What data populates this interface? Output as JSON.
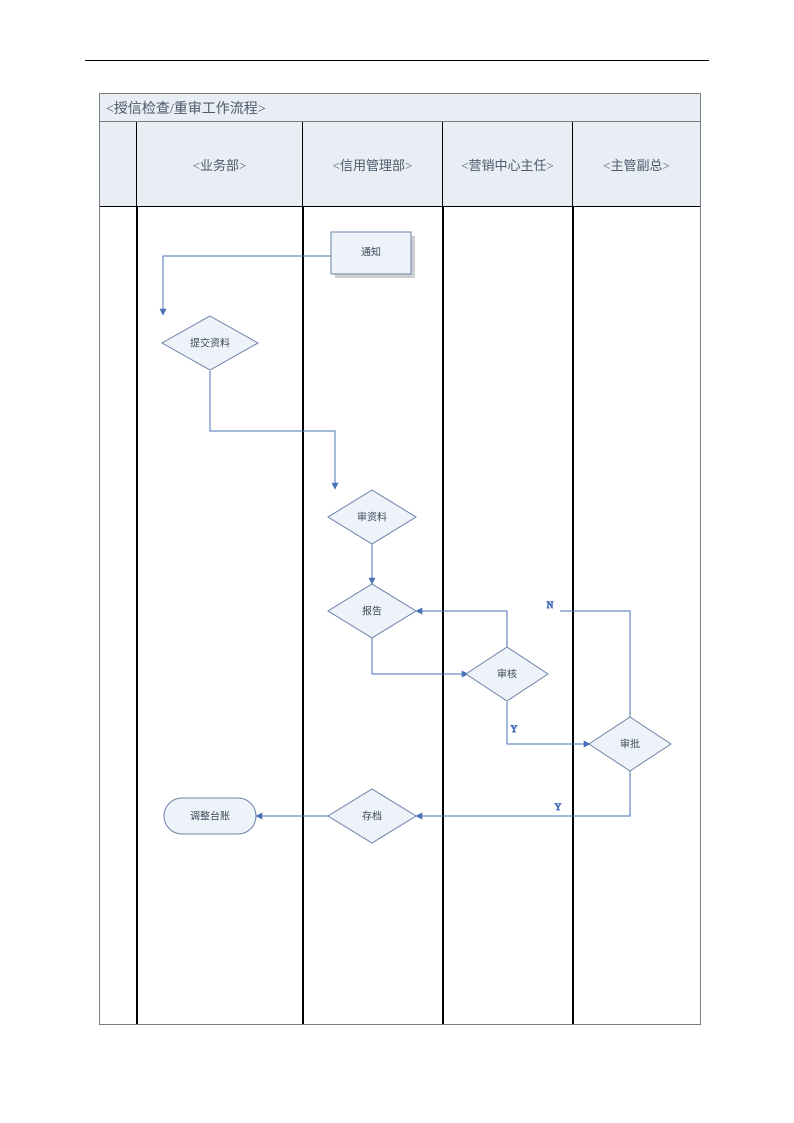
{
  "title": "<授信检查/重审工作流程>",
  "lanes": {
    "l1": "",
    "l2": "<业务部>",
    "l3": "<信用管理部>",
    "l4": "<营销中心主任>",
    "l5": "<主管副总>"
  },
  "nodes": {
    "notify": "通知",
    "submit": "提交资料",
    "reviewDoc": "审资料",
    "report": "报告",
    "audit": "审核",
    "approve": "审批",
    "archive": "存档",
    "adjust": "调整台账"
  },
  "edgeLabels": {
    "auditN": "N",
    "auditY": "Y",
    "approveY": "Y"
  },
  "chart_data": {
    "type": "flowchart-swimlane",
    "title": "授信检查/重审工作流程",
    "lanes": [
      {
        "id": "L1",
        "label": ""
      },
      {
        "id": "L2",
        "label": "业务部"
      },
      {
        "id": "L3",
        "label": "信用管理部"
      },
      {
        "id": "L4",
        "label": "营销中心主任"
      },
      {
        "id": "L5",
        "label": "主管副总"
      }
    ],
    "nodes": [
      {
        "id": "notify",
        "lane": "L3",
        "shape": "process",
        "label": "通知"
      },
      {
        "id": "submit",
        "lane": "L2",
        "shape": "decision",
        "label": "提交资料"
      },
      {
        "id": "reviewDoc",
        "lane": "L3",
        "shape": "decision",
        "label": "审资料"
      },
      {
        "id": "report",
        "lane": "L3",
        "shape": "decision",
        "label": "报告"
      },
      {
        "id": "audit",
        "lane": "L4",
        "shape": "decision",
        "label": "审核"
      },
      {
        "id": "approve",
        "lane": "L5",
        "shape": "decision",
        "label": "审批"
      },
      {
        "id": "archive",
        "lane": "L3",
        "shape": "decision",
        "label": "存档"
      },
      {
        "id": "adjust",
        "lane": "L2",
        "shape": "terminator",
        "label": "调整台账"
      }
    ],
    "edges": [
      {
        "from": "notify",
        "to": "submit",
        "label": ""
      },
      {
        "from": "submit",
        "to": "reviewDoc",
        "label": ""
      },
      {
        "from": "reviewDoc",
        "to": "report",
        "label": ""
      },
      {
        "from": "report",
        "to": "audit",
        "label": ""
      },
      {
        "from": "audit",
        "to": "report",
        "label": "N"
      },
      {
        "from": "audit",
        "to": "approve",
        "label": "Y"
      },
      {
        "from": "approve",
        "to": "report",
        "label": "N"
      },
      {
        "from": "approve",
        "to": "archive",
        "label": "Y"
      },
      {
        "from": "archive",
        "to": "adjust",
        "label": ""
      }
    ]
  }
}
